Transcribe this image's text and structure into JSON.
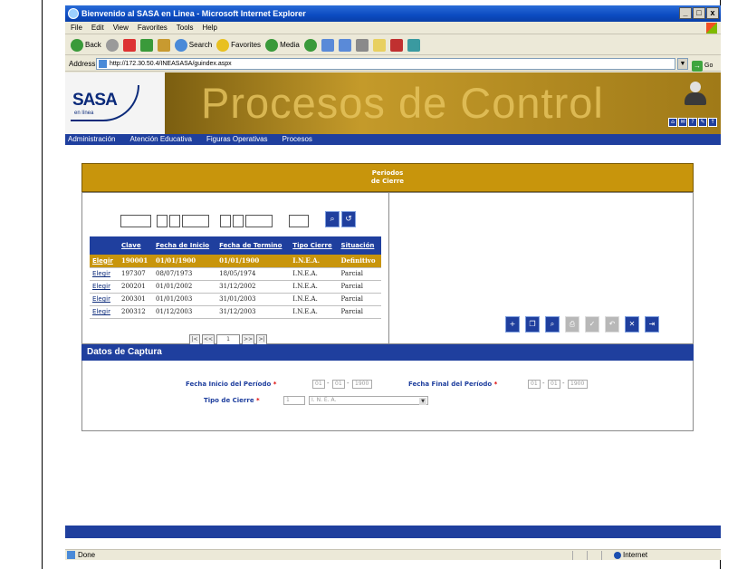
{
  "window": {
    "title": "Bienvenido al SASA en Linea - Microsoft Internet Explorer",
    "controls": [
      "_",
      "□",
      "x"
    ]
  },
  "menubar": [
    "File",
    "Edit",
    "View",
    "Favorites",
    "Tools",
    "Help"
  ],
  "toolbar": {
    "back": "Back",
    "search": "Search",
    "favorites": "Favorites",
    "media": "Media"
  },
  "address": {
    "label": "Address",
    "url": "http://172.30.50.4/INEASASA/guindex.aspx",
    "go": "Go"
  },
  "banner": {
    "logo": "SASA",
    "logo_sub": "en línea",
    "title": "Procesos de Control",
    "mini_buttons": [
      "⌂",
      "✉",
      "?",
      "✎",
      "↑"
    ]
  },
  "nav": [
    "Administración",
    "Atención Educativa",
    "Figuras Operativas",
    "Procesos"
  ],
  "panel": {
    "title_line1": "Periodos",
    "title_line2": "de Cierre"
  },
  "grid": {
    "columns": [
      "",
      "Clave",
      "Fecha de Inicio",
      "Fecha de Termino",
      "Tipo Cierre",
      "Situación"
    ],
    "rows": [
      {
        "action": "Elegir",
        "clave": "190001",
        "inicio": "01/01/1900",
        "termino": "01/01/1900",
        "tipo": "I.N.E.A.",
        "situacion": "Definitivo"
      },
      {
        "action": "Elegir",
        "clave": "197307",
        "inicio": "08/07/1973",
        "termino": "18/05/1974",
        "tipo": "I.N.E.A.",
        "situacion": "Parcial"
      },
      {
        "action": "Elegir",
        "clave": "200201",
        "inicio": "01/01/2002",
        "termino": "31/12/2002",
        "tipo": "I.N.E.A.",
        "situacion": "Parcial"
      },
      {
        "action": "Elegir",
        "clave": "200301",
        "inicio": "01/01/2003",
        "termino": "31/01/2003",
        "tipo": "I.N.E.A.",
        "situacion": "Parcial"
      },
      {
        "action": "Elegir",
        "clave": "200312",
        "inicio": "01/12/2003",
        "termino": "31/12/2003",
        "tipo": "I.N.E.A.",
        "situacion": "Parcial"
      }
    ],
    "pager": {
      "first": "|<",
      "prev": "<<",
      "page": "1",
      "next": ">>",
      "last": ">|"
    }
  },
  "captura": {
    "title": "Datos de Captura",
    "fecha_inicio_label": "Fecha Inicio del Período",
    "fecha_final_label": "Fecha Final del Período",
    "tipo_label": "Tipo de Cierre",
    "required": "*",
    "inicio": {
      "dd": "01",
      "mm": "01",
      "yyyy": "1900"
    },
    "final": {
      "dd": "01",
      "mm": "01",
      "yyyy": "1900"
    },
    "tipo_code": "1",
    "tipo_value": "I. N. E. A."
  },
  "status": {
    "left": "Done",
    "zone": "Internet"
  },
  "colors": {
    "accent_gold": "#c8950c",
    "accent_blue": "#1f3f9e",
    "required": "#dd0000"
  }
}
